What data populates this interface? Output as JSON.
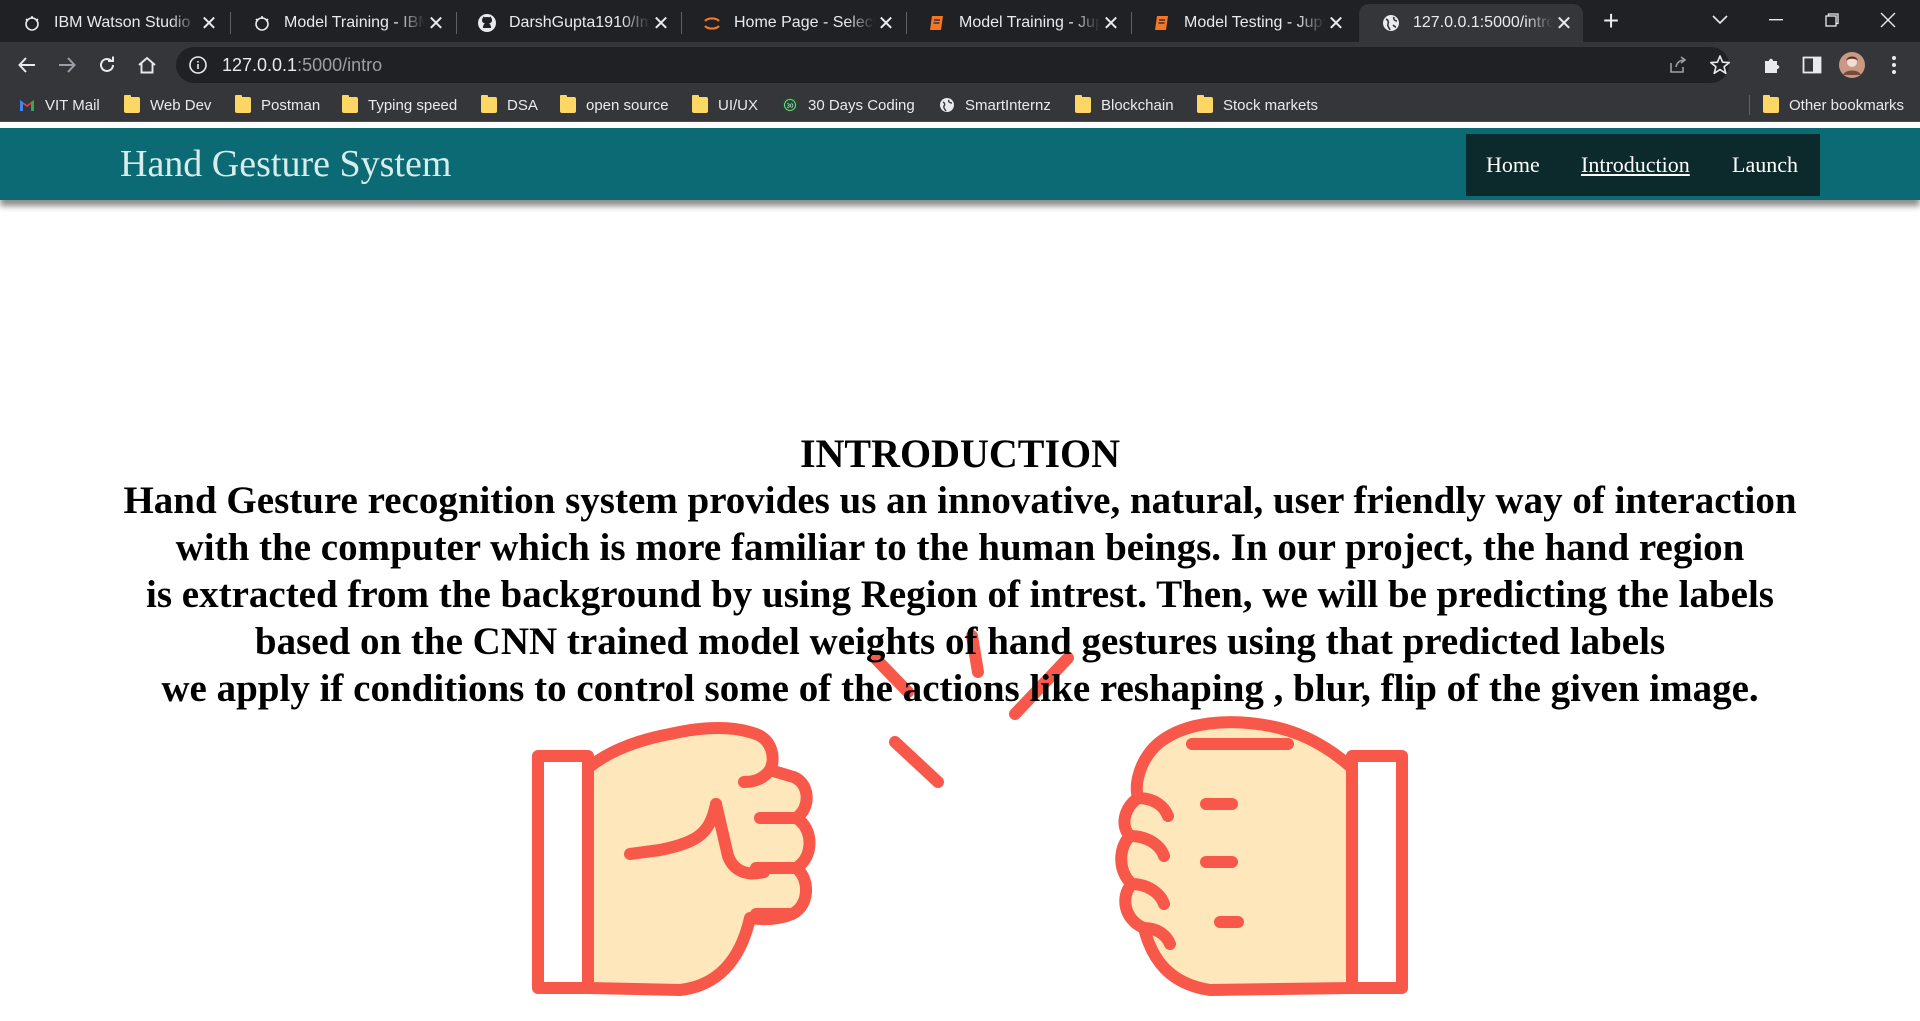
{
  "browser": {
    "tabs": [
      {
        "title": "IBM Watson Studio",
        "icon": "ibm-watson-icon"
      },
      {
        "title": "Model Training - IBM",
        "icon": "ibm-watson-icon"
      },
      {
        "title": "DarshGupta1910/Ima",
        "icon": "github-icon"
      },
      {
        "title": "Home Page - Select o",
        "icon": "jupyter-icon"
      },
      {
        "title": "Model Training - Jupy",
        "icon": "notebook-icon"
      },
      {
        "title": "Model Testing - Jupyt",
        "icon": "notebook-icon"
      },
      {
        "title": "127.0.0.1:5000/intro",
        "icon": "globe-icon",
        "active": true
      }
    ],
    "address": {
      "host": "127.0.0.1",
      "path": ":5000/intro"
    },
    "bookmarks": [
      {
        "label": "VIT Mail",
        "icon": "gmail-icon"
      },
      {
        "label": "Web Dev",
        "icon": "folder-icon"
      },
      {
        "label": "Postman",
        "icon": "folder-icon"
      },
      {
        "label": "Typing speed",
        "icon": "folder-icon"
      },
      {
        "label": "DSA",
        "icon": "folder-icon"
      },
      {
        "label": "open source",
        "icon": "folder-icon"
      },
      {
        "label": "UI/UX",
        "icon": "folder-icon"
      },
      {
        "label": "30 Days Coding",
        "icon": "badge-icon"
      },
      {
        "label": "SmartInternz",
        "icon": "globe-icon"
      },
      {
        "label": "Blockchain",
        "icon": "folder-icon"
      },
      {
        "label": "Stock markets",
        "icon": "folder-icon"
      }
    ],
    "other_bookmarks": "Other bookmarks",
    "colors": {
      "tabbar": "#202124",
      "toolbar": "#35363a",
      "folder": "#fdd663"
    }
  },
  "site": {
    "title": "Hand Gesture System",
    "nav": {
      "home": "Home",
      "introduction": "Introduction",
      "launch": "Launch"
    },
    "colors": {
      "header": "#0b6a73",
      "nav": "#0c2a2c",
      "stroke": "#f7584a",
      "skin": "#fde7bb"
    }
  },
  "intro": {
    "heading": "INTRODUCTION",
    "lines": [
      "Hand Gesture recognition system provides us an innovative, natural, user friendly way of interaction",
      "with the computer which is more familiar to the human beings. In our project, the hand region",
      "is extracted from the background by using Region of intrest. Then, we will be predicting the labels",
      "based on the CNN trained model weights of hand gestures using that predicted labels",
      "we apply if conditions to control some of the actions like reshaping , blur, flip of the given image."
    ]
  },
  "illustration": {
    "icon": "fist-bump-icon"
  }
}
